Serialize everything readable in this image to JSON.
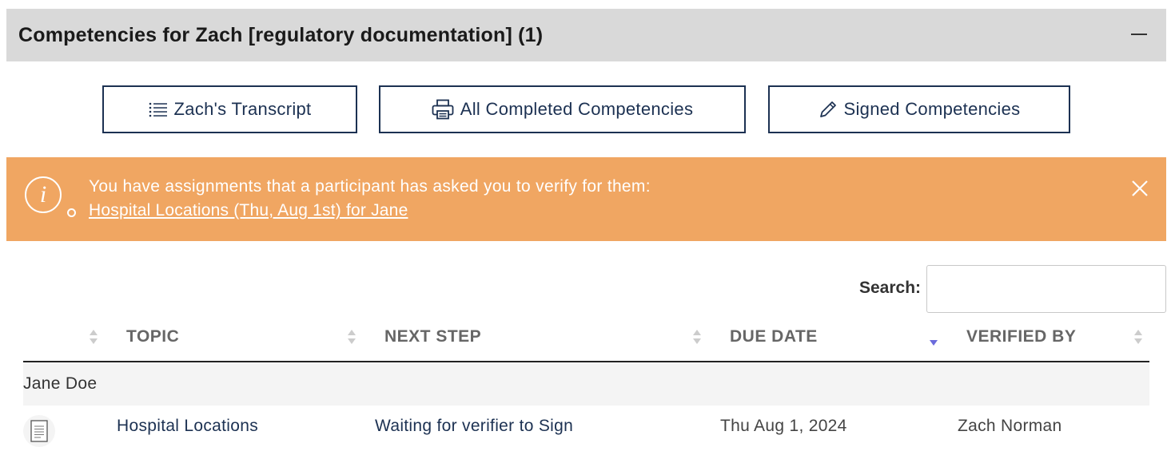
{
  "panel": {
    "title": "Competencies for Zach [regulatory documentation] (1)"
  },
  "buttons": {
    "transcript": "Zach's Transcript",
    "completed": "All Completed Competencies",
    "signed": "Signed Competencies"
  },
  "alert": {
    "message": "You have assignments that a participant has asked you to verify for them:",
    "link": "Hospital Locations (Thu, Aug 1st) for Jane",
    "color": "#f0a662"
  },
  "search": {
    "label": "Search:",
    "value": ""
  },
  "table": {
    "columns": [
      "TOPIC",
      "NEXT STEP",
      "DUE DATE",
      "VERIFIED BY"
    ],
    "sorted_column": "DUE DATE",
    "sort_direction": "descending",
    "groups": [
      {
        "label": "Jane Doe",
        "rows": [
          {
            "icon": "document-icon",
            "topic": "Hospital Locations",
            "next_step": "Waiting for verifier to Sign",
            "due_date": "Thu Aug 1, 2024",
            "verified_by": "Zach Norman"
          }
        ]
      }
    ]
  },
  "colors": {
    "primary": "#1c3152",
    "header_bg": "#d9d9d9",
    "sort_active": "#6b6bdc"
  }
}
